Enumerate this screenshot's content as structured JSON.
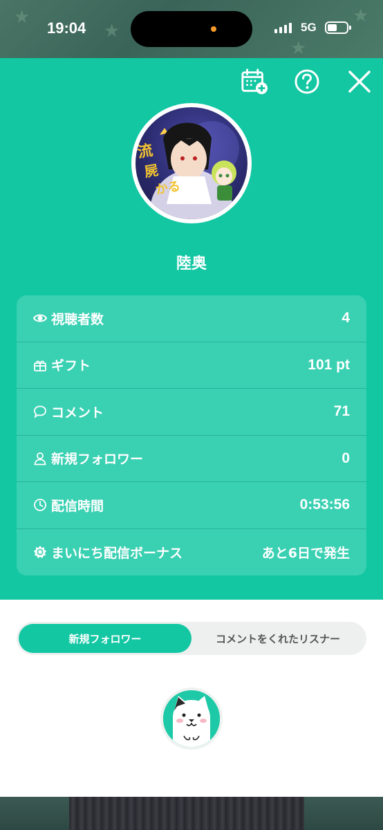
{
  "status_bar": {
    "time": "19:04",
    "network": "5G"
  },
  "header": {
    "icons": [
      "calendar-add-icon",
      "help-icon",
      "close-icon"
    ]
  },
  "profile": {
    "username": "陸奥"
  },
  "stats": [
    {
      "icon": "eye-icon",
      "label": "視聴者数",
      "value": "4"
    },
    {
      "icon": "gift-icon",
      "label": "ギフト",
      "value": "101 pt"
    },
    {
      "icon": "comment-icon",
      "label": "コメント",
      "value": "71"
    },
    {
      "icon": "person-icon",
      "label": "新規フォロワー",
      "value": "0"
    },
    {
      "icon": "clock-icon",
      "label": "配信時間",
      "value": "0:53:56"
    },
    {
      "icon": "sun-icon",
      "label": "まいにち配信ボーナス",
      "value": "あと6日で発生"
    }
  ],
  "tabs": {
    "new_followers": "新規フォロワー",
    "commenters": "コメントをくれたリスナー"
  },
  "colors": {
    "accent": "#13c7a3",
    "card": "rgba(255,255,255,0.17)",
    "tab_inactive_bg": "#eef0ef"
  }
}
